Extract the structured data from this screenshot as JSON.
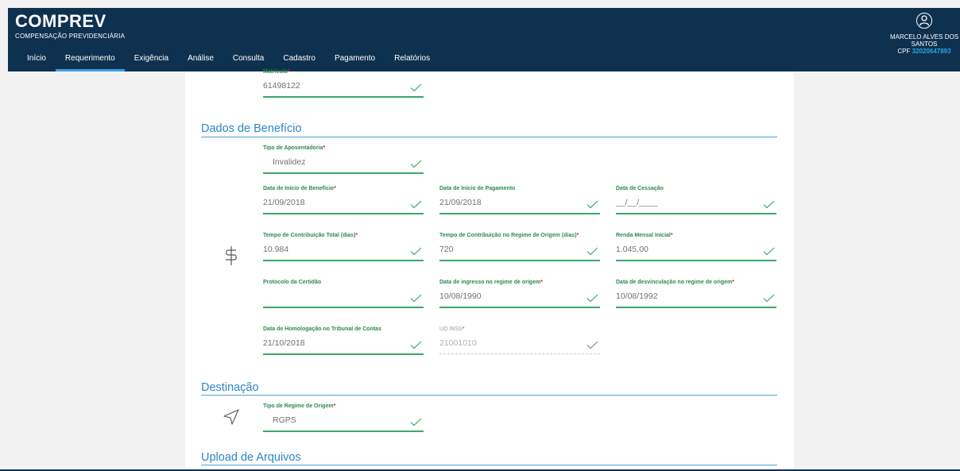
{
  "app": {
    "title": "COMPREV",
    "subtitle": "COMPENSAÇÃO PREVIDENCIÁRIA"
  },
  "nav": {
    "items": [
      {
        "label": "Início"
      },
      {
        "label": "Requerimento"
      },
      {
        "label": "Exigência"
      },
      {
        "label": "Análise"
      },
      {
        "label": "Consulta"
      },
      {
        "label": "Cadastro"
      },
      {
        "label": "Pagamento"
      },
      {
        "label": "Relatórios"
      }
    ],
    "active": "Requerimento"
  },
  "user": {
    "name": "MARCELO ALVES DOS SANTOS",
    "cpf_label": "CPF",
    "cpf_value": "32020647893"
  },
  "form": {
    "matricula": {
      "label": "Matrícula",
      "required": "*",
      "value": "61498122"
    },
    "sections": {
      "beneficio": "Dados de Benefício",
      "destinacao": "Destinação",
      "upload": "Upload de Arquivos"
    },
    "tipo_aposentadoria": {
      "label": "Tipo de Aposentadoria",
      "required": "*",
      "value": "Invalidez"
    },
    "data_inicio_beneficio": {
      "label": "Data de Início de Benefício",
      "required": "*",
      "value": "21/09/2018"
    },
    "data_inicio_pagamento": {
      "label": "Data de Início de Pagamento",
      "value": "21/09/2018"
    },
    "data_cessacao": {
      "label": "Data de Cessação",
      "value": "__/__/____"
    },
    "tempo_contribuicao_total": {
      "label": "Tempo de Contribuição Total (dias)",
      "required": "*",
      "value": "10.984"
    },
    "tempo_contribuicao_origem": {
      "label": "Tempo de Contribuição no Regime de Origem (dias)",
      "required": "*",
      "value": "720"
    },
    "renda_mensal_inicial": {
      "label": "Renda Mensal Inicial",
      "required": "*",
      "value": "1.045,00"
    },
    "protocolo_certidao": {
      "label": "Protocolo da Certidão",
      "value": ""
    },
    "data_ingresso_origem": {
      "label": "Data de ingresso no regime de origem",
      "required": "*",
      "value": "10/08/1990"
    },
    "data_desvinculacao_origem": {
      "label": "Data de desvinculação no regime de origem",
      "required": "*",
      "value": "10/08/1992"
    },
    "data_homologacao": {
      "label": "Data de Homologação no Tribunal de Contas",
      "value": "21/10/2018"
    },
    "uo_inss": {
      "label": "UO INSS",
      "required": "*",
      "value": "21001010"
    },
    "tipo_regime_origem": {
      "label": "Tipo de Regime de Origem",
      "required": "*",
      "value": "RGPS"
    }
  },
  "icons": {
    "user": "user-circle-icon",
    "benefit": "dollar-icon",
    "destination": "send-arrow-icon",
    "valid": "check-icon"
  },
  "colors": {
    "header": "#0f3150",
    "accent": "#3a9fe0",
    "field_line": "#3aa968",
    "label": "#2d8a4e",
    "required": "#e0211b",
    "section": "#2b86c5"
  }
}
